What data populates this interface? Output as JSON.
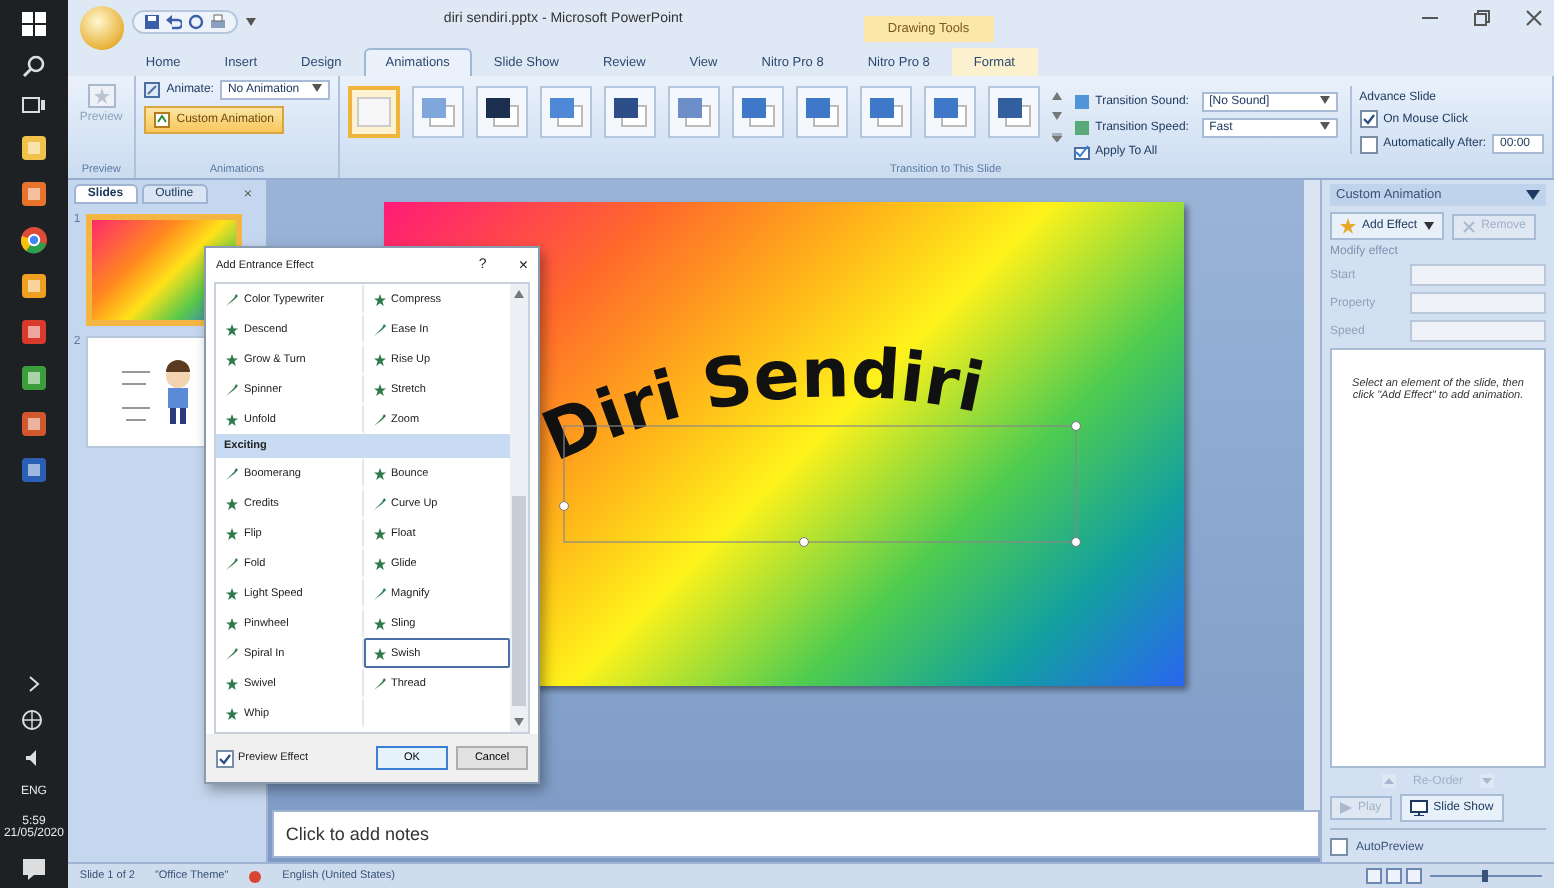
{
  "taskbar": {
    "language": "ENG",
    "time": "5:59",
    "date": "21/05/2020"
  },
  "window": {
    "title": "diri sendiri.pptx - Microsoft PowerPoint",
    "contextual_tab": "Drawing Tools"
  },
  "ribbon_tabs": [
    {
      "label": "Home",
      "selected": false
    },
    {
      "label": "Insert",
      "selected": false
    },
    {
      "label": "Design",
      "selected": false
    },
    {
      "label": "Animations",
      "selected": true
    },
    {
      "label": "Slide Show",
      "selected": false
    },
    {
      "label": "Review",
      "selected": false
    },
    {
      "label": "View",
      "selected": false
    },
    {
      "label": "Nitro Pro 8",
      "selected": false
    },
    {
      "label": "Nitro Pro 8",
      "selected": false
    },
    {
      "label": "Format",
      "selected": false
    }
  ],
  "ribbon": {
    "preview_group": {
      "button": "Preview",
      "label": "Preview"
    },
    "animations_group": {
      "animate_label": "Animate:",
      "animate_value": "No Animation",
      "custom_animation": "Custom Animation",
      "label": "Animations"
    },
    "transitions_group": {
      "label": "Transition to This Slide",
      "thumbnails": [
        {
          "selected": true
        },
        {
          "selected": false
        },
        {
          "selected": false
        },
        {
          "selected": false
        },
        {
          "selected": false
        },
        {
          "selected": false
        },
        {
          "selected": false
        },
        {
          "selected": false
        },
        {
          "selected": false
        },
        {
          "selected": false
        },
        {
          "selected": false
        }
      ],
      "sound": {
        "label": "Transition Sound:",
        "value": "[No Sound]"
      },
      "speed": {
        "label": "Transition Speed:",
        "value": "Fast"
      },
      "apply_to_all": "Apply To All",
      "advance_slide": {
        "title": "Advance Slide",
        "on_mouse_click": {
          "label": "On Mouse Click",
          "checked": true
        },
        "automatically_after": {
          "label": "Automatically After:",
          "checked": false,
          "value": "00:00"
        }
      }
    }
  },
  "slides_pane": {
    "tabs": [
      {
        "label": "Slides",
        "selected": true
      },
      {
        "label": "Outline",
        "selected": false
      }
    ],
    "close": "×",
    "slides": [
      {
        "number": "1",
        "selected": true
      },
      {
        "number": "2",
        "selected": false
      }
    ]
  },
  "slide": {
    "title": "Diri Sendiri"
  },
  "notes": {
    "placeholder": "Click to add notes"
  },
  "dialog": {
    "title": "Add Entrance Effect",
    "help": "?",
    "close": "×",
    "sections": [
      {
        "items": [
          {
            "label": "Color Typewriter",
            "selected": false
          },
          {
            "label": "Compress",
            "selected": false
          },
          {
            "label": "Descend",
            "selected": false
          },
          {
            "label": "Ease In",
            "selected": false
          },
          {
            "label": "Grow & Turn",
            "selected": false
          },
          {
            "label": "Rise Up",
            "selected": false
          },
          {
            "label": "Spinner",
            "selected": false
          },
          {
            "label": "Stretch",
            "selected": false
          },
          {
            "label": "Unfold",
            "selected": false
          },
          {
            "label": "Zoom",
            "selected": false
          }
        ]
      },
      {
        "heading": "Exciting",
        "items": [
          {
            "label": "Boomerang",
            "selected": false
          },
          {
            "label": "Bounce",
            "selected": false
          },
          {
            "label": "Credits",
            "selected": false
          },
          {
            "label": "Curve Up",
            "selected": false
          },
          {
            "label": "Flip",
            "selected": false
          },
          {
            "label": "Float",
            "selected": false
          },
          {
            "label": "Fold",
            "selected": false
          },
          {
            "label": "Glide",
            "selected": false
          },
          {
            "label": "Light Speed",
            "selected": false
          },
          {
            "label": "Magnify",
            "selected": false
          },
          {
            "label": "Pinwheel",
            "selected": false
          },
          {
            "label": "Sling",
            "selected": false
          },
          {
            "label": "Spiral In",
            "selected": false
          },
          {
            "label": "Swish",
            "selected": true
          },
          {
            "label": "Swivel",
            "selected": false
          },
          {
            "label": "Thread",
            "selected": false
          },
          {
            "label": "Whip",
            "selected": false
          }
        ]
      }
    ],
    "preview_effect": {
      "label": "Preview Effect",
      "checked": true
    },
    "buttons": [
      "OK",
      "Cancel"
    ]
  },
  "task_pane": {
    "title": "Custom Animation",
    "add_effect": "Add Effect",
    "remove": {
      "label": "Remove",
      "disabled": true
    },
    "modify_heading": "Modify effect",
    "fields": [
      "Start",
      "Property",
      "Speed"
    ],
    "message": "Select an element of the slide, then click \"Add Effect\" to add animation.",
    "reorder": "Re-Order",
    "play": {
      "label": "Play",
      "disabled": true
    },
    "slide_show": "Slide Show",
    "autopreview": {
      "label": "AutoPreview",
      "checked": false
    }
  },
  "status_bar": {
    "slide": "Slide 1 of 2",
    "theme": "\"Office Theme\"",
    "language": "English (United States)"
  }
}
